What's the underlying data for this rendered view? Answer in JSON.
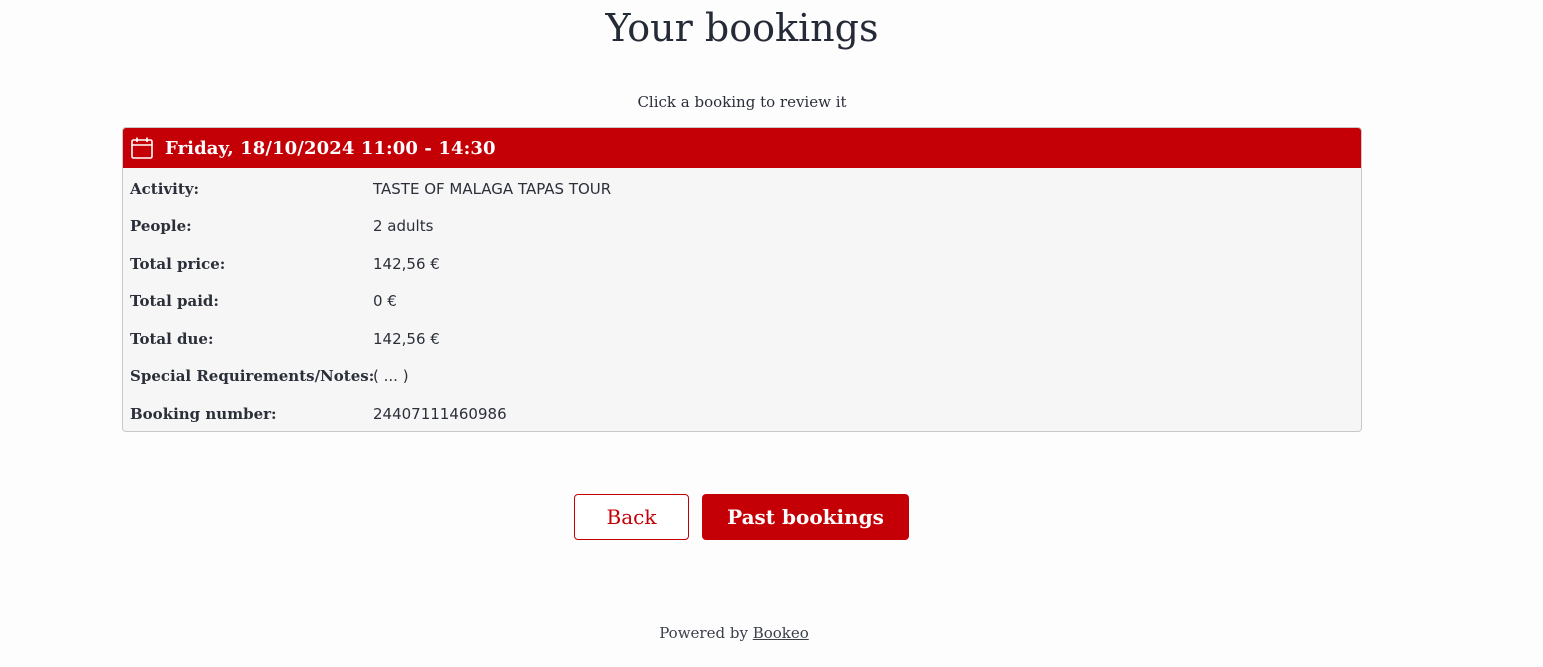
{
  "page": {
    "title": "Your bookings",
    "subtitle": "Click a booking to review it"
  },
  "booking": {
    "date_time": "Friday, 18/10/2024 11:00 - 14:30",
    "icon": "calendar-icon",
    "rows": [
      {
        "label": "Activity:",
        "value": "TASTE OF MALAGA TAPAS TOUR"
      },
      {
        "label": "People:",
        "value": "2 adults"
      },
      {
        "label": "Total price:",
        "value": "142,56 €"
      },
      {
        "label": "Total paid:",
        "value": "0 €"
      },
      {
        "label": "Total due:",
        "value": "142,56 €"
      },
      {
        "label": "Special Requirements/Notes:",
        "value": "( ... )"
      },
      {
        "label": "Booking number:",
        "value": "24407111460986"
      }
    ]
  },
  "buttons": {
    "back_label": "Back",
    "past_label": "Past bookings"
  },
  "footer": {
    "powered_by": "Powered by",
    "brand_link": "Bookeo"
  },
  "colors": {
    "accent": "#c40006",
    "card_background": "#f6f6f6",
    "text": "#2b2f3a"
  }
}
